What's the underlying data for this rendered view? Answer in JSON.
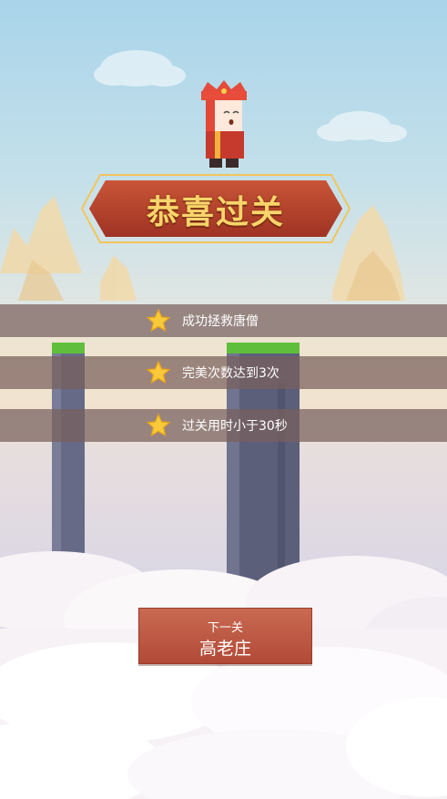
{
  "title": "恭喜过关",
  "achievements": [
    {
      "icon": "star-icon",
      "text": "成功拯救唐僧"
    },
    {
      "icon": "star-icon",
      "text": "完美次数达到3次"
    },
    {
      "icon": "star-icon",
      "text": "过关用时小于30秒"
    }
  ],
  "next_button": {
    "caption": "下一关",
    "level_name": "高老庄"
  },
  "colors": {
    "banner": "#785f5c",
    "button": "#b85540",
    "title_text": "#f7d56a",
    "pillar_top": "#5fbf3c"
  }
}
